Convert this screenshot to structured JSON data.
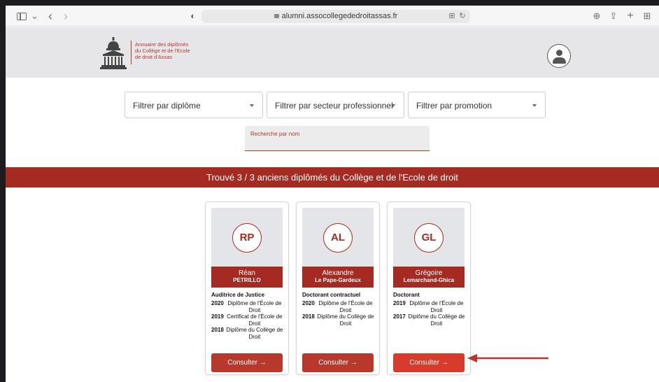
{
  "browser": {
    "url": "alumni.assocollegededroitassas.fr",
    "controls": {
      "back": "‹",
      "forward": "›",
      "chevron": "⌄",
      "shield": "◐",
      "translate": "⊞",
      "reload": "↻",
      "download": "⊕",
      "share": "⇪",
      "new_tab": "+",
      "tabs": "⊞"
    }
  },
  "header": {
    "logo_lines": [
      "Annuaire des diplômés",
      "du Collège et de l'Ecole",
      "de droit d'Assas"
    ],
    "accent_color": "#a52b22"
  },
  "filters": [
    {
      "label": "Filtrer par diplôme"
    },
    {
      "label": "Filtrer par secteur professionnel"
    },
    {
      "label": "Filtrer par promotion"
    }
  ],
  "search": {
    "placeholder": "Recherche par nom"
  },
  "results_banner": "Trouvé 3 / 3 anciens diplômés du Collège et de l'Ecole de droit",
  "cards": [
    {
      "initials": "RP",
      "first_name": "Réan",
      "last_name": "PETRILLO",
      "role": "Auditrice de Justice",
      "diplomas": [
        {
          "year": "2020",
          "title": "Diplôme de l'École de Droit"
        },
        {
          "year": "2019",
          "title": "Certificat de l'École de Droit"
        },
        {
          "year": "2018",
          "title": "Diplôme du Collège de Droit"
        }
      ],
      "button": "Consulter →"
    },
    {
      "initials": "AL",
      "first_name": "Alexandre",
      "last_name": "Le Pape-Gardeux",
      "role": "Doctorant contractuel",
      "diplomas": [
        {
          "year": "2020",
          "title": "Diplôme de l'École de Droit"
        },
        {
          "year": "2018",
          "title": "Diplôme du Collège de Droit"
        }
      ],
      "button": "Consulter →"
    },
    {
      "initials": "GL",
      "first_name": "Grégoire",
      "last_name": "Lemarchand-Ghica",
      "role": "Doctorant",
      "diplomas": [
        {
          "year": "2019",
          "title": "Diplôme de l'École de Droit"
        },
        {
          "year": "2017",
          "title": "Diplôme du Collège de Droit"
        }
      ],
      "button": "Consulter →"
    }
  ]
}
